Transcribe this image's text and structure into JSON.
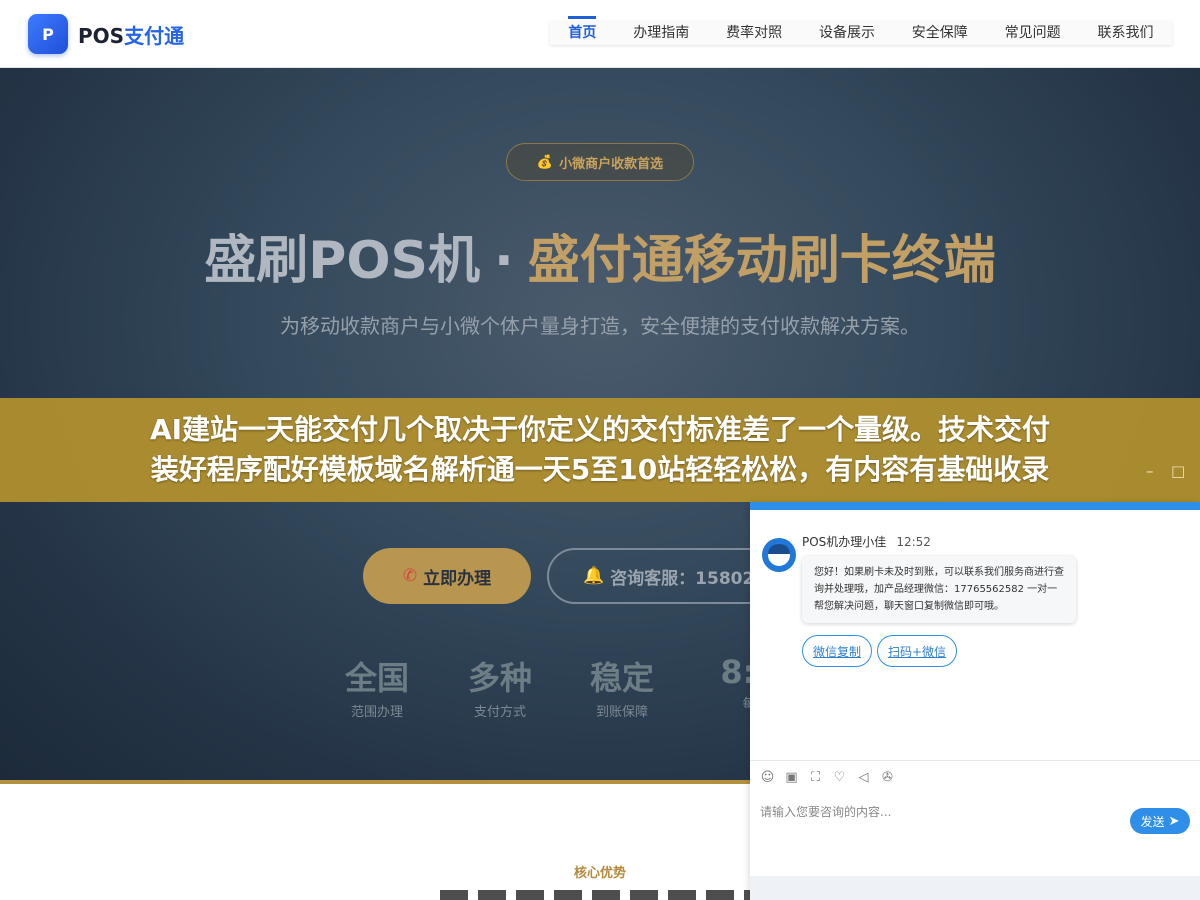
{
  "header": {
    "logo_mark": "P",
    "logo_text_a": "POS",
    "logo_text_b": "支付通",
    "nav": [
      "首页",
      "办理指南",
      "费率对照",
      "设备展示",
      "安全保障",
      "常见问题",
      "联系我们"
    ]
  },
  "hero": {
    "badge_icon": "money-bag-icon",
    "badge": "小微商户收款首选",
    "title_a": "盛刷POS机",
    "title_sep": "·",
    "title_b": "盛付通移动刷卡终端",
    "subtitle": "为移动收款商户与小微个体户量身打造，安全便捷的支付收款解决方案。",
    "btn_primary": "立即办理",
    "btn_secondary": "咨询客服：158028",
    "stats": [
      {
        "value": "全国",
        "label": "范围办理"
      },
      {
        "value": "多种",
        "label": "支付方式"
      },
      {
        "value": "稳定",
        "label": "到账保障"
      },
      {
        "value": "8:3",
        "label": "每"
      }
    ]
  },
  "overlay": {
    "line1": "AI建站一天能交付几个取决于你定义的交付标准差了一个量级。技术交付",
    "line2": "装好程序配好模板域名解析通一天5至10站轻轻松松，有内容有基础收录",
    "minimize": "–",
    "maximize": "□"
  },
  "section": {
    "label": "核心优势"
  },
  "chat": {
    "sender": "POS机办理小佳",
    "time": "12:52",
    "message": "您好！如果刷卡未及时到账，可以联系我们服务商进行查询并处理哦，加产品经理微信：17765562582 一对一帮您解决问题，聊天窗口复制微信即可哦。",
    "btn_copy": "微信复制",
    "btn_scan": "扫码+微信",
    "input_placeholder": "请输入您要咨询的内容...",
    "send": "发送"
  },
  "colors": {
    "brand_blue": "#2563eb",
    "gold": "#b8964f",
    "chat_blue": "#2f8fe8",
    "overlay": "#b4912d"
  }
}
